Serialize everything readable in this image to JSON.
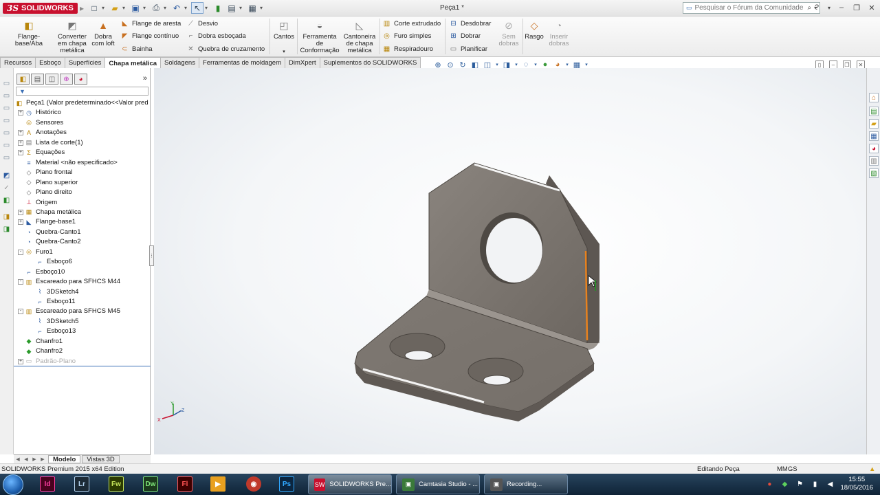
{
  "window": {
    "brand": "SOLIDWORKS",
    "document_title": "Peça1 *",
    "search_placeholder": "Pesquisar o Fórum da Comunidade"
  },
  "ribbon": {
    "flange_base": "Flange-base/Aba",
    "converter": "Converter em chapa metálica",
    "dobra_loft": "Dobra com loft",
    "flange_aresta": "Flange de aresta",
    "flange_continuo": "Flange contínuo",
    "bainha": "Bainha",
    "desvio": "Desvio",
    "dobra_esbocada": "Dobra esboçada",
    "quebra_cruzamento": "Quebra de cruzamento",
    "cantos": "Cantos",
    "ferramenta_conformacao": "Ferramenta de Conformação",
    "cantoneira": "Cantoneira de chapa metálica",
    "corte_extrudado": "Corte extrudado",
    "furo_simples": "Furo simples",
    "respiradouro": "Respiradouro",
    "desdobrar": "Desdobrar",
    "dobrar": "Dobrar",
    "planificar": "Planificar",
    "sem_dobras": "Sem dobras",
    "rasgo": "Rasgo",
    "inserir_dobras": "Inserir dobras"
  },
  "tabs": [
    {
      "label": "Recursos"
    },
    {
      "label": "Esboço"
    },
    {
      "label": "Superfícies"
    },
    {
      "label": "Chapa metálica"
    },
    {
      "label": "Soldagens"
    },
    {
      "label": "Ferramentas de moldagem"
    },
    {
      "label": "DimXpert"
    },
    {
      "label": "Suplementos do SOLIDWORKS"
    }
  ],
  "tree": [
    {
      "label": "Peça1  (Valor predeterminado<<Valor pred",
      "icon": "part-icon",
      "level": 0,
      "expander": ""
    },
    {
      "label": "Histórico",
      "icon": "history-icon",
      "level": 1,
      "expander": "+"
    },
    {
      "label": "Sensores",
      "icon": "sensor-icon",
      "level": 1,
      "expander": ""
    },
    {
      "label": "Anotações",
      "icon": "annotation-icon",
      "level": 1,
      "expander": "+"
    },
    {
      "label": "Lista de corte(1)",
      "icon": "cutlist-icon",
      "level": 1,
      "expander": "+"
    },
    {
      "label": "Equações",
      "icon": "equation-icon",
      "level": 1,
      "expander": "+"
    },
    {
      "label": "Material <não especificado>",
      "icon": "material-icon",
      "level": 1,
      "expander": ""
    },
    {
      "label": "Plano frontal",
      "icon": "plane-icon",
      "level": 1,
      "expander": ""
    },
    {
      "label": "Plano superior",
      "icon": "plane-icon",
      "level": 1,
      "expander": ""
    },
    {
      "label": "Plano direito",
      "icon": "plane-icon",
      "level": 1,
      "expander": ""
    },
    {
      "label": "Origem",
      "icon": "origin-icon",
      "level": 1,
      "expander": ""
    },
    {
      "label": "Chapa metálica",
      "icon": "sheetmetal-icon",
      "level": 1,
      "expander": "+"
    },
    {
      "label": "Flange-base1",
      "icon": "flange-icon",
      "level": 1,
      "expander": "+"
    },
    {
      "label": "Quebra-Canto1",
      "icon": "break-corner-icon",
      "level": 1,
      "expander": ""
    },
    {
      "label": "Quebra-Canto2",
      "icon": "break-corner-icon",
      "level": 1,
      "expander": ""
    },
    {
      "label": "Furo1",
      "icon": "hole-icon",
      "level": 1,
      "expander": "-"
    },
    {
      "label": "Esboço6",
      "icon": "sketch-icon",
      "level": 2,
      "expander": ""
    },
    {
      "label": "Esboço10",
      "icon": "sketch-icon",
      "level": 1,
      "expander": ""
    },
    {
      "label": "Escareado para SFHCS M44",
      "icon": "hole-wizard-icon",
      "level": 1,
      "expander": "-"
    },
    {
      "label": "3DSketch4",
      "icon": "sketch3d-icon",
      "level": 2,
      "expander": ""
    },
    {
      "label": "Esboço11",
      "icon": "sketch-icon",
      "level": 2,
      "expander": ""
    },
    {
      "label": "Escareado para SFHCS M45",
      "icon": "hole-wizard-icon",
      "level": 1,
      "expander": "-"
    },
    {
      "label": "3DSketch5",
      "icon": "sketch3d-icon",
      "level": 2,
      "expander": ""
    },
    {
      "label": "Esboço13",
      "icon": "sketch-icon",
      "level": 2,
      "expander": ""
    },
    {
      "label": "Chanfro1",
      "icon": "chamfer-icon",
      "level": 1,
      "expander": ""
    },
    {
      "label": "Chanfro2",
      "icon": "chamfer-icon",
      "level": 1,
      "expander": ""
    },
    {
      "label": "Padrão-Plano",
      "icon": "flatpattern-icon",
      "level": 1,
      "expander": "+"
    }
  ],
  "bottom_tabs": {
    "modelo": "Modelo",
    "vistas3d": "Vistas 3D"
  },
  "status": {
    "edition": "SOLIDWORKS Premium 2015 x64 Edition",
    "mode": "Editando Peça",
    "units": "MMGS"
  },
  "taskbar": {
    "solidworks": "SOLIDWORKS Pre...",
    "camtasia": "Camtasia Studio - ...",
    "recording": "Recording...",
    "time": "15:55",
    "date": "18/05/2016"
  },
  "colors": {
    "brand_red": "#c8102e",
    "part_gray": "#7d7670",
    "selected_edge": "#e8821e"
  }
}
